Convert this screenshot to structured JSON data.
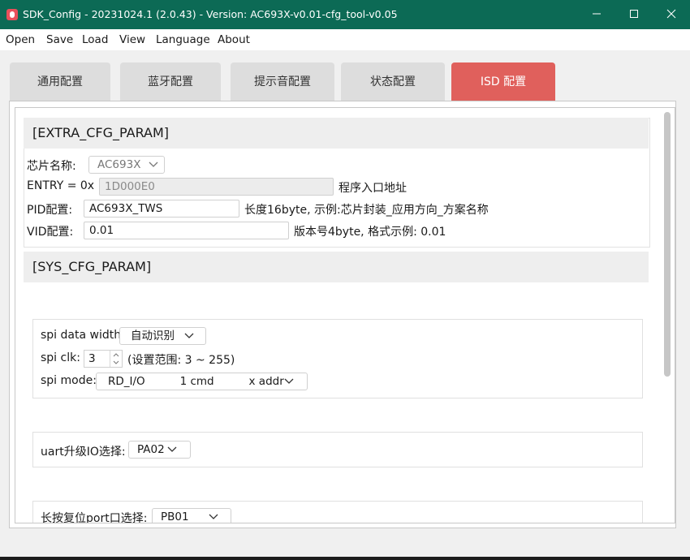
{
  "window": {
    "title": "SDK_Config -  20231024.1  (2.0.43) - Version: AC693X-v0.01-cfg_tool-v0.05",
    "minimize": "–",
    "maximize": "☐",
    "close": "✕"
  },
  "menu": [
    "Open",
    "Save",
    "Load",
    "View",
    "Language",
    "About"
  ],
  "tabs": [
    {
      "label": "通用配置",
      "active": false
    },
    {
      "label": "蓝牙配置",
      "active": false
    },
    {
      "label": "提示音配置",
      "active": false
    },
    {
      "label": "状态配置",
      "active": false
    },
    {
      "label": "ISD 配置",
      "active": true
    }
  ],
  "extra_cfg": {
    "header": "[EXTRA_CFG_PARAM]",
    "chip_label": "芯片名称:",
    "chip_value": "AC693X",
    "entry_label": "ENTRY = 0x",
    "entry_value": "1D000E0",
    "entry_hint": "程序入口地址",
    "pid_label": "PID配置:",
    "pid_value": "AC693X_TWS",
    "pid_hint": "长度16byte, 示例:芯片封装_应用方向_方案名称",
    "vid_label": "VID配置:",
    "vid_value": "0.01",
    "vid_hint": "版本号4byte, 格式示例: 0.01"
  },
  "sys_cfg": {
    "header": "[SYS_CFG_PARAM]",
    "spi_width_label": "spi data width:",
    "spi_width_value": "自动识别",
    "spi_clk_label": "spi clk:",
    "spi_clk_value": "3",
    "spi_clk_hint": "(设置范围: 3 ~ 255)",
    "spi_mode_label": "spi mode:",
    "spi_mode_value": "RD_I/O          1 cmd          x addr",
    "uart_label": "uart升级IO选择:",
    "uart_value": "PA02",
    "reset_label": "长按复位port口选择:",
    "reset_value": "PB01"
  },
  "colors": {
    "titlebar": "#0c6a55",
    "active_tab": "#e0605c",
    "app_icon": "#e8505b"
  }
}
